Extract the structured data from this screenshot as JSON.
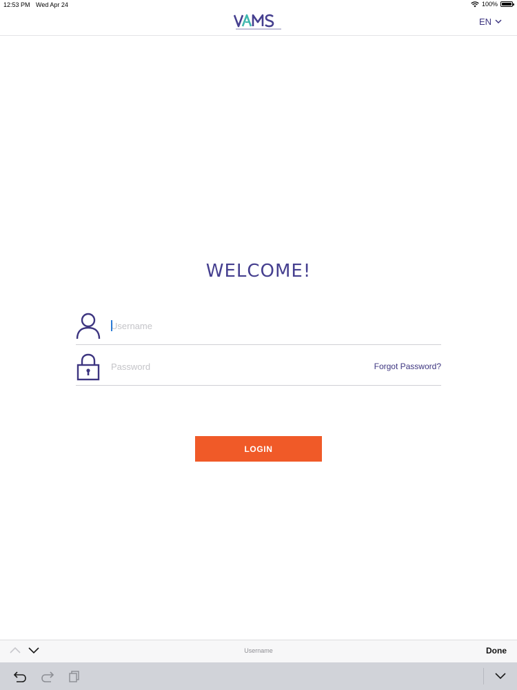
{
  "status_bar": {
    "time": "12:53 PM",
    "date": "Wed Apr 24",
    "battery": "100%",
    "icons": [
      "wifi-icon",
      "battery-icon"
    ]
  },
  "header": {
    "logo_text": "VAMS",
    "language": "EN",
    "language_icon": "chevron-down-icon"
  },
  "main": {
    "welcome_title": "WELCOME!",
    "username": {
      "placeholder": "Username",
      "value": "",
      "icon": "user-icon"
    },
    "password": {
      "placeholder": "Password",
      "value": "",
      "icon": "lock-icon"
    },
    "forgot_password_label": "Forgot Password?",
    "login_label": "LOGIN"
  },
  "keyboard_accessory": {
    "field_label": "Username",
    "done_label": "Done",
    "icons": [
      "chevron-up-icon",
      "chevron-down-icon"
    ]
  },
  "keyboard_shortcuts": {
    "icons": [
      "undo-icon",
      "redo-icon",
      "paste-icon",
      "keyboard-dismiss-icon"
    ]
  },
  "colors": {
    "brand_purple": "#453f8f",
    "accent_orange": "#f05a28",
    "logo_teal": "#3fb7ae",
    "caret_blue": "#2b7bd6"
  }
}
